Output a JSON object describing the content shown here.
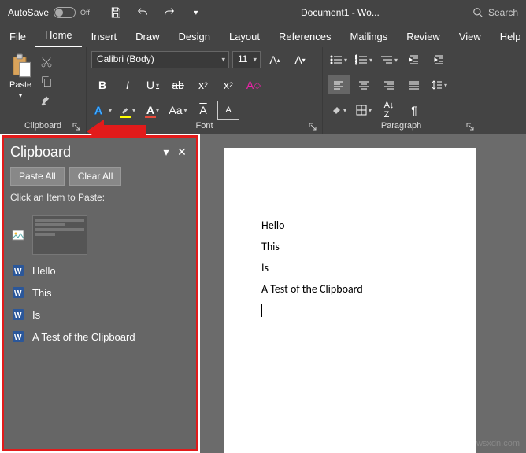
{
  "titlebar": {
    "autosave": "AutoSave",
    "autosave_state": "Off",
    "doc_title": "Document1 - Wo...",
    "search_placeholder": "Search"
  },
  "tabs": [
    "File",
    "Home",
    "Insert",
    "Draw",
    "Design",
    "Layout",
    "References",
    "Mailings",
    "Review",
    "View",
    "Help"
  ],
  "active_tab": 1,
  "ribbon": {
    "clipboard": {
      "label": "Clipboard",
      "paste": "Paste"
    },
    "font": {
      "label": "Font",
      "font_name": "Calibri (Body)",
      "font_size": "11"
    },
    "paragraph": {
      "label": "Paragraph"
    }
  },
  "clipboard_pane": {
    "title": "Clipboard",
    "paste_all": "Paste All",
    "clear_all": "Clear All",
    "hint": "Click an Item to Paste:",
    "items": [
      {
        "type": "image",
        "text": ""
      },
      {
        "type": "word",
        "text": "Hello"
      },
      {
        "type": "word",
        "text": "This"
      },
      {
        "type": "word",
        "text": "Is"
      },
      {
        "type": "word",
        "text": "A Test of the Clipboard"
      }
    ]
  },
  "document": {
    "lines": [
      "Hello",
      "This",
      "Is",
      "A Test of the Clipboard"
    ]
  },
  "watermark": "wsxdn.com"
}
